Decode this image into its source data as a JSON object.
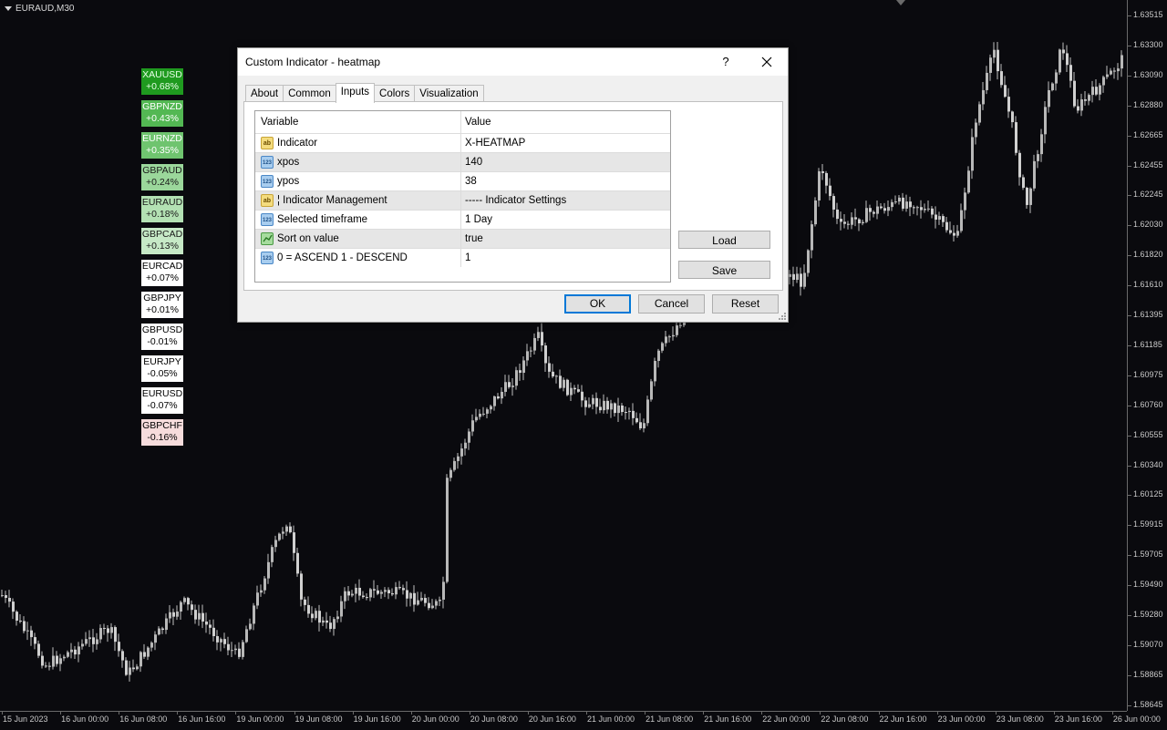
{
  "chart": {
    "symbol": "EURAUD,M30",
    "price_labels": [
      "1.63515",
      "1.63300",
      "1.63090",
      "1.62880",
      "1.62665",
      "1.62455",
      "1.62245",
      "1.62030",
      "1.61820",
      "1.61610",
      "1.61395",
      "1.61185",
      "1.60975",
      "1.60760",
      "1.60555",
      "1.60340",
      "1.60125",
      "1.59915",
      "1.59705",
      "1.59490",
      "1.59280",
      "1.59070",
      "1.58865",
      "1.58645"
    ],
    "time_labels": [
      "15 Jun 2023",
      "16 Jun 00:00",
      "16 Jun 08:00",
      "16 Jun 16:00",
      "19 Jun 00:00",
      "19 Jun 08:00",
      "19 Jun 16:00",
      "20 Jun 00:00",
      "20 Jun 08:00",
      "20 Jun 16:00",
      "21 Jun 00:00",
      "21 Jun 08:00",
      "21 Jun 16:00",
      "22 Jun 00:00",
      "22 Jun 08:00",
      "22 Jun 16:00",
      "23 Jun 00:00",
      "23 Jun 08:00",
      "23 Jun 16:00",
      "26 Jun 00:00"
    ],
    "candle_color": "#c0c0c0"
  },
  "heatmap": [
    {
      "symbol": "XAUUSD",
      "change": "+0.68%",
      "bg": "#1f9a1f",
      "fg": "#e8ffe8"
    },
    {
      "symbol": "GBPNZD",
      "change": "+0.43%",
      "bg": "#53b853",
      "fg": "#ffffff"
    },
    {
      "symbol": "EURNZD",
      "change": "+0.35%",
      "bg": "#6fc46f",
      "fg": "#ffffff"
    },
    {
      "symbol": "GBPAUD",
      "change": "+0.24%",
      "bg": "#9bd79b",
      "fg": "#1a1a1a"
    },
    {
      "symbol": "EURAUD",
      "change": "+0.18%",
      "bg": "#b3e1b3",
      "fg": "#1a1a1a"
    },
    {
      "symbol": "GBPCAD",
      "change": "+0.13%",
      "bg": "#c6e9c6",
      "fg": "#1a1a1a"
    },
    {
      "symbol": "EURCAD",
      "change": "+0.07%",
      "bg": "#ffffff",
      "fg": "#000000"
    },
    {
      "symbol": "GBPJPY",
      "change": "+0.01%",
      "bg": "#ffffff",
      "fg": "#000000"
    },
    {
      "symbol": "GBPUSD",
      "change": "-0.01%",
      "bg": "#ffffff",
      "fg": "#000000"
    },
    {
      "symbol": "EURJPY",
      "change": "-0.05%",
      "bg": "#ffffff",
      "fg": "#000000"
    },
    {
      "symbol": "EURUSD",
      "change": "-0.07%",
      "bg": "#ffffff",
      "fg": "#000000"
    },
    {
      "symbol": "GBPCHF",
      "change": "-0.16%",
      "bg": "#f6dcdc",
      "fg": "#000000"
    }
  ],
  "dialog": {
    "title": "Custom Indicator - heatmap",
    "help": "?",
    "tabs": [
      "About",
      "Common",
      "Inputs",
      "Colors",
      "Visualization"
    ],
    "active_tab": "Inputs",
    "grid_headers": {
      "variable": "Variable",
      "value": "Value"
    },
    "rows": [
      {
        "icon": "abc",
        "variable": "Indicator",
        "value": "X-HEATMAP"
      },
      {
        "icon": "num",
        "variable": "xpos",
        "value": "140"
      },
      {
        "icon": "num",
        "variable": "ypos",
        "value": "38"
      },
      {
        "icon": "abc",
        "variable": "¦ Indicator Management",
        "value": "----- Indicator Settings"
      },
      {
        "icon": "num",
        "variable": "Selected timeframe",
        "value": "1 Day"
      },
      {
        "icon": "bool",
        "variable": "Sort on value",
        "value": "true"
      },
      {
        "icon": "num",
        "variable": "0 = ASCEND 1 - DESCEND",
        "value": "1"
      }
    ],
    "buttons": {
      "load": "Load",
      "save": "Save",
      "ok": "OK",
      "cancel": "Cancel",
      "reset": "Reset"
    }
  }
}
